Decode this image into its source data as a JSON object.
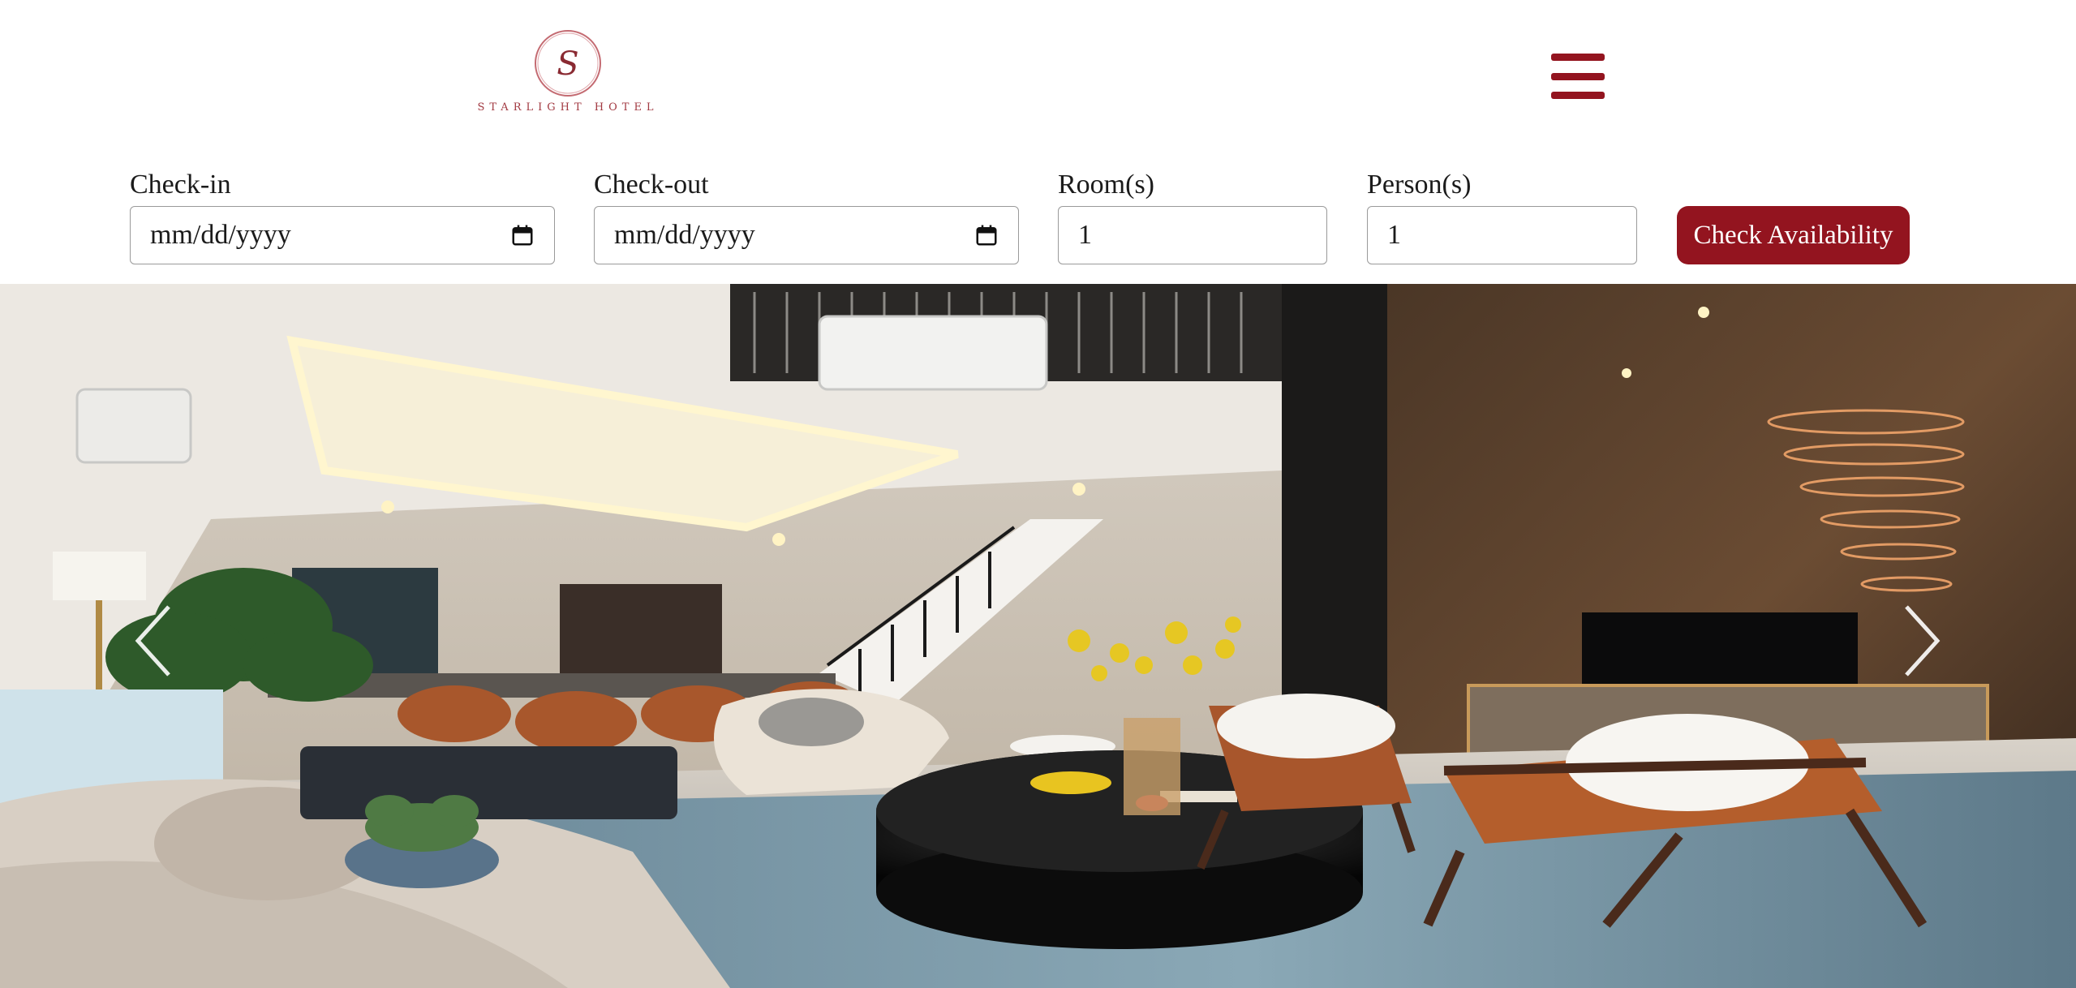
{
  "brand": {
    "name": "STARLIGHT HOTEL",
    "monogram": "S",
    "color": "#a23a42"
  },
  "header": {
    "menu_icon": "hamburger-menu-icon",
    "accent_color": "#93141f"
  },
  "booking": {
    "check_in": {
      "label": "Check-in",
      "placeholder": "mm/dd/yyyy",
      "icon": "calendar-icon"
    },
    "check_out": {
      "label": "Check-out",
      "placeholder": "mm/dd/yyyy",
      "icon": "calendar-icon"
    },
    "rooms": {
      "label": "Room(s)",
      "value": "1"
    },
    "persons": {
      "label": "Person(s)",
      "value": "1"
    },
    "submit_label": "Check Availability"
  },
  "hero": {
    "prev_icon": "chevron-left-icon",
    "next_icon": "chevron-right-icon"
  }
}
